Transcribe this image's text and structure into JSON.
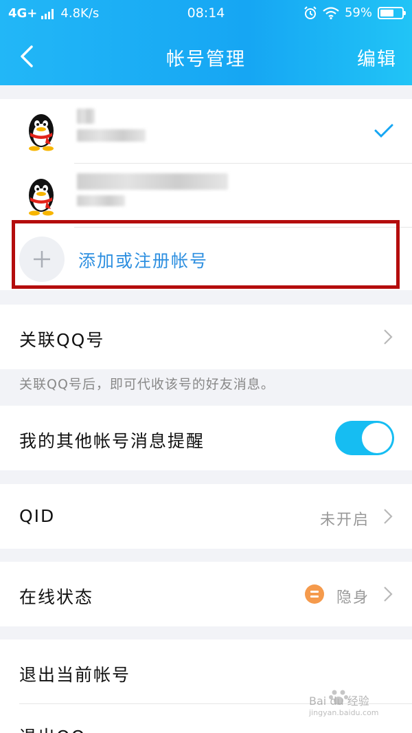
{
  "statusbar": {
    "network": "4G+",
    "speed": "4.8K/s",
    "time": "08:14",
    "battery": "59%"
  },
  "nav": {
    "title": "帐号管理",
    "edit": "编辑"
  },
  "add_account": {
    "label": "添加或注册帐号"
  },
  "linked_qq": {
    "label": "关联QQ号",
    "hint": "关联QQ号后，即可代收该号的好友消息。"
  },
  "other_alert": {
    "label": "我的其他帐号消息提醒",
    "enabled": true
  },
  "qid": {
    "label": "QID",
    "value": "未开启"
  },
  "online_status": {
    "label": "在线状态",
    "value": "隐身"
  },
  "logout_current": {
    "label": "退出当前帐号"
  },
  "logout_qq": {
    "label": "退出QQ"
  },
  "watermark": {
    "text": "Bai du 经验",
    "sub": "jingyan.baidu.com"
  },
  "colors": {
    "accent": "#16a6f3",
    "link": "#2d8fe0",
    "toggle_on": "#16bdf2",
    "status_orange": "#f59a4c",
    "highlight": "#b40d0d"
  }
}
